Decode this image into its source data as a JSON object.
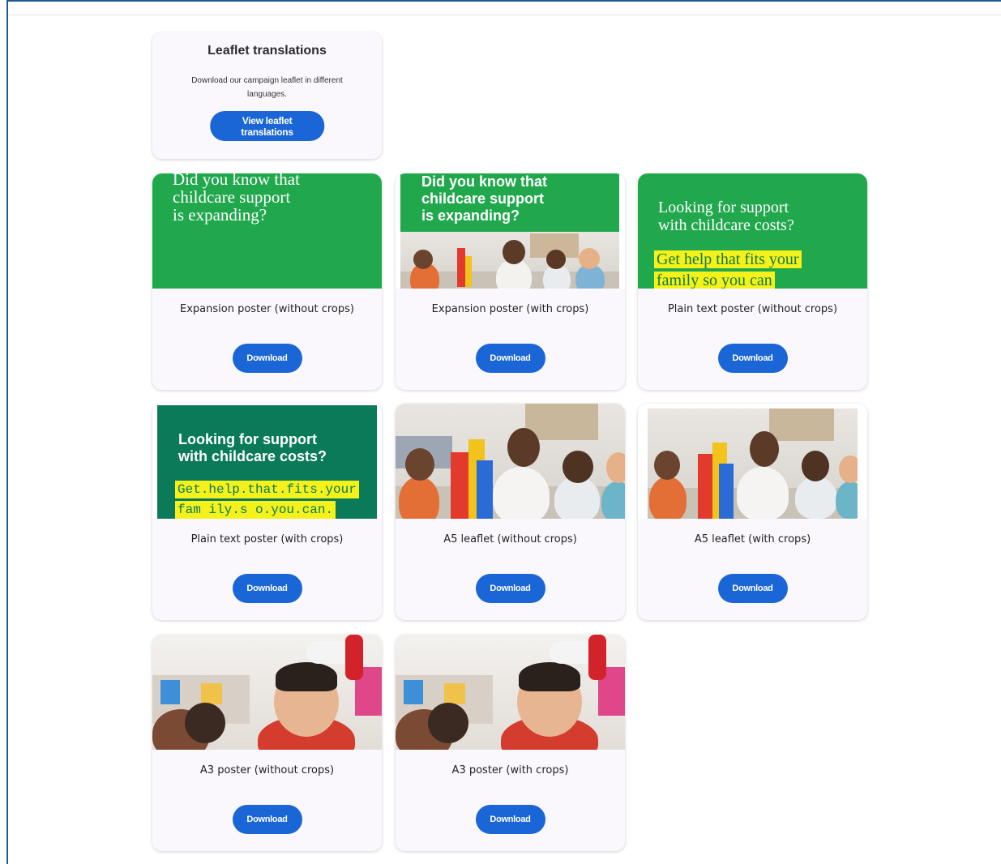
{
  "leaflet_card": {
    "title": "Leaflet translations",
    "description": "Download our campaign leaflet in different languages.",
    "button_label": "View leaflet translations"
  },
  "resources": [
    {
      "title": "Expansion poster (without crops)",
      "button_label": "Download",
      "poster_text": [
        "Did you know that",
        "childcare support",
        "is expanding?"
      ]
    },
    {
      "title": "Expansion poster (with crops)",
      "button_label": "Download",
      "poster_text": [
        "Did you know that",
        "childcare support",
        "is expanding?"
      ]
    },
    {
      "title": "Plain text poster (without crops)",
      "button_label": "Download",
      "poster_text": [
        "Looking for support",
        "with childcare costs?"
      ],
      "highlight_text": [
        "Get help that fits your",
        "family so you can"
      ]
    },
    {
      "title": "Plain text poster (with crops)",
      "button_label": "Download",
      "poster_text": [
        "Looking for support",
        "with childcare costs?"
      ],
      "highlight_text": [
        "Get.help.that.fits.your",
        "fam ily.s o.you.can."
      ]
    },
    {
      "title": "A5 leaflet (without crops)",
      "button_label": "Download"
    },
    {
      "title": "A5 leaflet (with crops)",
      "button_label": "Download"
    },
    {
      "title": "A3 poster (without crops)",
      "button_label": "Download"
    },
    {
      "title": "A3 poster (with crops)",
      "button_label": "Download"
    }
  ],
  "colors": {
    "button": "#1a66d6",
    "poster_green": "#21a84d",
    "poster_dark_green": "#0a7a59",
    "highlight_yellow": "#f4f21a",
    "card_bg": "#fbf8fd"
  }
}
